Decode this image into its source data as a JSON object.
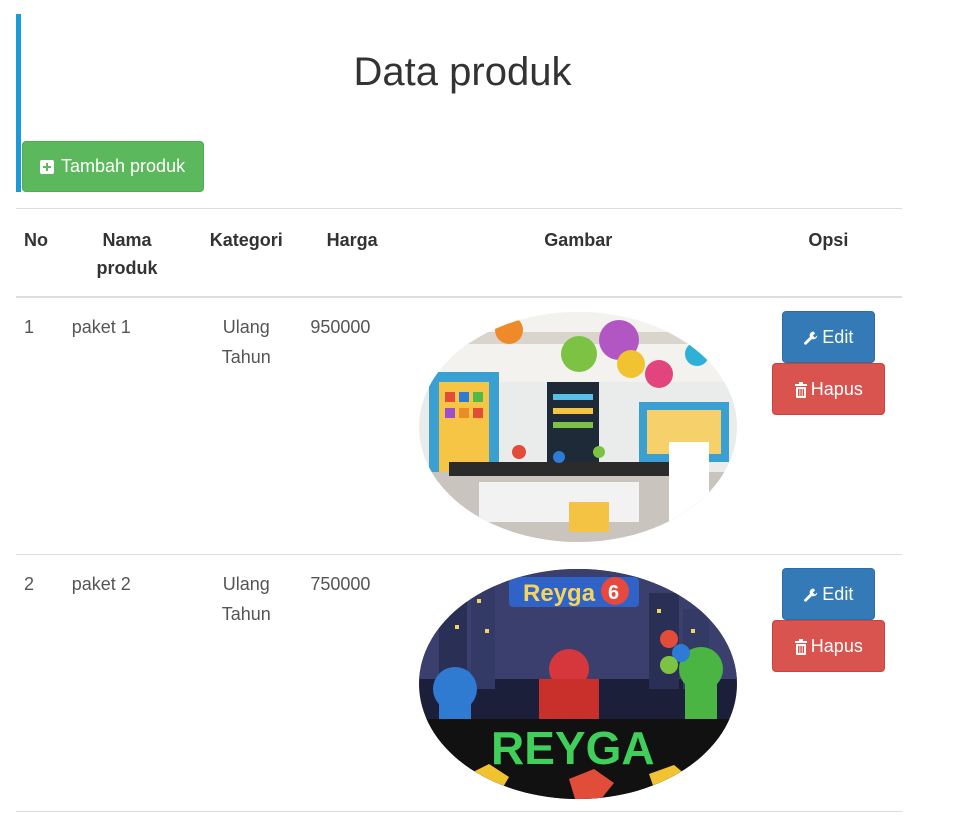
{
  "page": {
    "title": "Data produk",
    "add_button_label": "Tambah produk"
  },
  "table": {
    "headers": {
      "no": "No",
      "name": "Nama produk",
      "category": "Kategori",
      "price": "Harga",
      "image": "Gambar",
      "options": "Opsi"
    },
    "rows": [
      {
        "no": "1",
        "name": "paket 1",
        "category": "Ulang Tahun",
        "price": "950000",
        "image_alt": "classroom-party-decoration-photo",
        "edit_label": "Edit",
        "delete_label": "Hapus"
      },
      {
        "no": "2",
        "name": "paket 2",
        "category": "Ulang Tahun",
        "price": "750000",
        "image_alt": "pj-masks-birthday-stage-photo",
        "image_text_top": "Reyga",
        "image_text_bottom": "REYGA",
        "image_badge": "6",
        "edit_label": "Edit",
        "delete_label": "Hapus"
      }
    ]
  },
  "colors": {
    "accent": "#1a9ad6",
    "success": "#5cb85c",
    "primary": "#337ab7",
    "danger": "#d9534f"
  },
  "icons": {
    "add": "plus-square-icon",
    "edit": "wrench-icon",
    "delete": "trash-icon"
  }
}
